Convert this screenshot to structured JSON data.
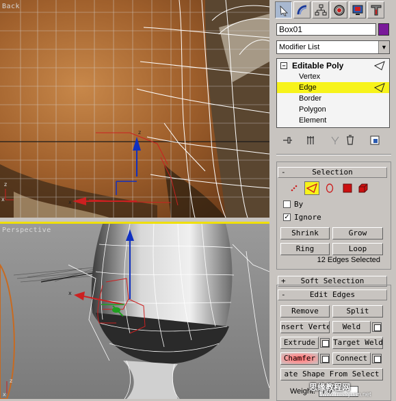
{
  "viewports": {
    "top_label": "Back",
    "bottom_label": "Perspective"
  },
  "panel": {
    "tab_icons": [
      "create-icon",
      "modify-icon",
      "hierarchy-icon",
      "motion-icon",
      "display-icon",
      "utilities-icon"
    ],
    "object_name": "Box01",
    "object_color": "#7a1a9a",
    "modifier_list": "Modifier List",
    "stack": {
      "expand_sign": "−",
      "root": "Editable Poly",
      "items": [
        "Vertex",
        "Edge",
        "Border",
        "Polygon",
        "Element"
      ],
      "selected": "Edge"
    },
    "stack_tools": [
      "pin-stack-icon",
      "show-end-result-icon",
      "make-unique-icon",
      "remove-modifier-icon",
      "configure-sets-icon"
    ]
  },
  "selection": {
    "title": "Selection",
    "sign": "-",
    "by_label": "By",
    "ignore_label": "Ignore",
    "by_checked": "",
    "ignore_checked": "✓",
    "shrink": "Shrink",
    "grow": "Grow",
    "ring": "Ring",
    "loop": "Loop",
    "status": "12 Edges Selected"
  },
  "soft_selection": {
    "title": "Soft Selection",
    "sign": "+"
  },
  "edit_edges": {
    "title": "Edit Edges",
    "sign": "-",
    "remove": "Remove",
    "split": "Split",
    "insert_vertex": "nsert Verte",
    "weld": "Weld",
    "extrude": "Extrude",
    "target_weld": "Target Weld",
    "chamfer": "Chamfer",
    "connect": "Connect",
    "create_shape": "ate Shape From Select",
    "weight_label": "Weight:",
    "weight_value": "1.0"
  },
  "watermark": {
    "text": "思缘教程网",
    "url": "www.missyuan.net"
  },
  "colors": {
    "selection_highlight": "#f7f31a",
    "active_viewport_border": "#f0e000"
  }
}
